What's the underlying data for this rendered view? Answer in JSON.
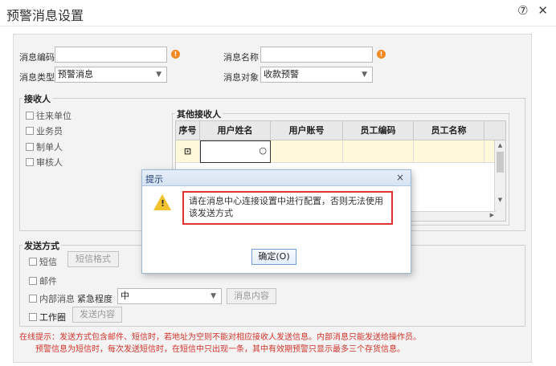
{
  "window": {
    "title": "预警消息设置",
    "help_glyph": "⑦",
    "close_glyph": "✕"
  },
  "form": {
    "code_label": "消息编码",
    "name_label": "消息名称",
    "type_label": "消息类型",
    "type_value": "预警消息",
    "target_label": "消息对象",
    "target_value": "收款预警",
    "required_mark": "!"
  },
  "receivers": {
    "title": "接收人",
    "options": [
      "往来单位",
      "业务员",
      "制单人",
      "审核人"
    ]
  },
  "other_receivers": {
    "title": "其他接收人",
    "columns": [
      "序号",
      "用户姓名",
      "用户账号",
      "员工编码",
      "员工名称"
    ],
    "row_icon": "⊡"
  },
  "send": {
    "title": "发送方式",
    "sms_label": "短信",
    "sms_format_button": "短信格式",
    "mail_label": "邮件",
    "internal_label": "内部消息",
    "urgency_label": "紧急程度",
    "urgency_value": "中",
    "message_content_button": "消息内容",
    "workbench_label": "工作圈",
    "send_content_button": "发送内容"
  },
  "tips": {
    "line1": "在线提示：发送方式包含邮件、短信时，若地址为空则不能对相应接收人发送信息。内部消息只能发送给操作员。",
    "line2": "预警信息为短信时，每次发送短信时，在短信中只出现一条，其中有效期预警只显示最多三个存货信息。"
  },
  "dialog": {
    "title": "提示",
    "close_glyph": "×",
    "warning_glyph": "!",
    "message": "请在消息中心连接设置中进行配置，否则无法使用该发送方式",
    "ok_button": "确定(O)"
  },
  "colors": {
    "accent_red": "#d0342c",
    "warning_orange": "#f08a24",
    "dialog_blue": "#9ab7d6"
  }
}
